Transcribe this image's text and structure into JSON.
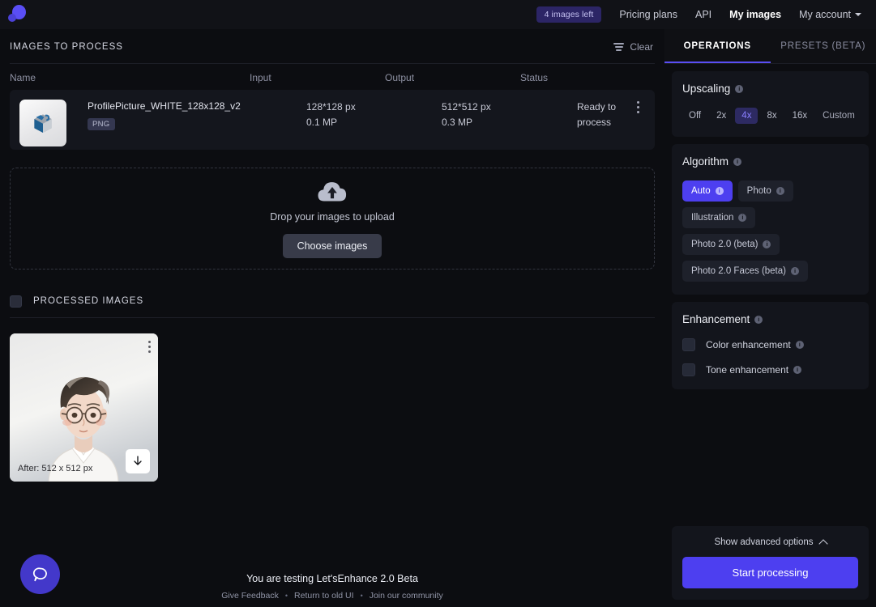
{
  "nav": {
    "logo_icon": "letsenhance-logo",
    "badge": "4 images left",
    "links": [
      {
        "label": "Pricing plans",
        "active": false
      },
      {
        "label": "API",
        "active": false
      },
      {
        "label": "My images",
        "active": true
      }
    ],
    "account": "My account"
  },
  "images_to_process": {
    "title": "IMAGES TO PROCESS",
    "clear_label": "Clear",
    "columns": [
      "Name",
      "Input",
      "Output",
      "Status"
    ],
    "rows": [
      {
        "name": "ProfilePicture_WHITE_128x128_v2",
        "format_tag": "PNG",
        "input_size": "128*128 px",
        "input_mp": "0.1 MP",
        "output_size": "512*512 px",
        "output_mp": "0.3 MP",
        "status": "Ready to process"
      }
    ]
  },
  "dropzone": {
    "icon": "cloud-upload-icon",
    "text": "Drop your images to upload",
    "button": "Choose images"
  },
  "processed": {
    "title": "PROCESSED IMAGES",
    "cards": [
      {
        "caption": "After: 512 x 512 px"
      }
    ]
  },
  "footer": {
    "title": "You are testing Let'sEnhance 2.0 Beta",
    "links": [
      "Give Feedback",
      "Return to old UI",
      "Join our community"
    ],
    "separator": "•"
  },
  "chat": {
    "icon": "chat-bubble-icon"
  },
  "panel": {
    "tabs": [
      {
        "label": "OPERATIONS",
        "active": true
      },
      {
        "label": "PRESETS (BETA)",
        "active": false
      }
    ],
    "upscaling": {
      "title": "Upscaling",
      "options": [
        {
          "label": "Off",
          "selected": false
        },
        {
          "label": "2x",
          "selected": false
        },
        {
          "label": "4x",
          "selected": true
        },
        {
          "label": "8x",
          "selected": false
        },
        {
          "label": "16x",
          "selected": false
        },
        {
          "label": "Custom",
          "selected": false
        }
      ]
    },
    "algorithm": {
      "title": "Algorithm",
      "options": [
        {
          "label": "Auto",
          "selected": true
        },
        {
          "label": "Photo",
          "selected": false
        },
        {
          "label": "Illustration",
          "selected": false
        },
        {
          "label": "Photo 2.0 (beta)",
          "selected": false
        },
        {
          "label": "Photo 2.0 Faces (beta)",
          "selected": false
        }
      ]
    },
    "enhancement": {
      "title": "Enhancement",
      "options": [
        {
          "label": "Color enhancement",
          "checked": false
        },
        {
          "label": "Tone enhancement",
          "checked": false
        }
      ]
    },
    "advanced_label": "Show advanced options",
    "start_label": "Start processing"
  },
  "colors": {
    "accent": "#4d3ff0",
    "accent_soft": "#5a4ef5",
    "panel_bg": "#13151c",
    "page_bg": "#0c0d11",
    "badge_bg": "#2c2566"
  }
}
